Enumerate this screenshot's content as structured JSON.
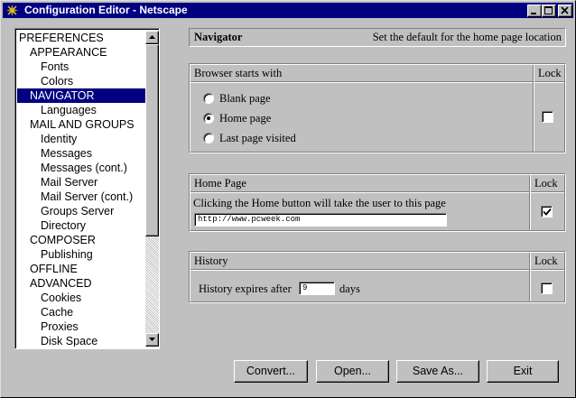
{
  "window": {
    "title": "Configuration Editor - Netscape",
    "titlebar_color": "#000080"
  },
  "tree": {
    "items": [
      {
        "label": "PREFERENCES",
        "level": 0
      },
      {
        "label": "APPEARANCE",
        "level": 1
      },
      {
        "label": "Fonts",
        "level": 2
      },
      {
        "label": "Colors",
        "level": 2
      },
      {
        "label": "NAVIGATOR",
        "level": 1,
        "selected": true
      },
      {
        "label": "Languages",
        "level": 2
      },
      {
        "label": "MAIL AND GROUPS",
        "level": 1
      },
      {
        "label": "Identity",
        "level": 2
      },
      {
        "label": "Messages",
        "level": 2
      },
      {
        "label": "Messages (cont.)",
        "level": 2
      },
      {
        "label": "Mail Server",
        "level": 2
      },
      {
        "label": "Mail Server (cont.)",
        "level": 2
      },
      {
        "label": "Groups Server",
        "level": 2
      },
      {
        "label": "Directory",
        "level": 2
      },
      {
        "label": "COMPOSER",
        "level": 1
      },
      {
        "label": "Publishing",
        "level": 2
      },
      {
        "label": "OFFLINE",
        "level": 1
      },
      {
        "label": "ADVANCED",
        "level": 1
      },
      {
        "label": "Cookies",
        "level": 2
      },
      {
        "label": "Cache",
        "level": 2
      },
      {
        "label": "Proxies",
        "level": 2
      },
      {
        "label": "Disk Space",
        "level": 2
      }
    ],
    "selection_color": "#000080"
  },
  "header": {
    "title": "Navigator",
    "description": "Set the default for the home page location"
  },
  "browser_starts": {
    "heading": "Browser starts with",
    "lock_label": "Lock",
    "options": [
      "Blank page",
      "Home page",
      "Last page visited"
    ],
    "selected_option": "Home page",
    "locked": false
  },
  "home_page": {
    "heading": "Home Page",
    "lock_label": "Lock",
    "description": "Clicking the Home button will take the user to this page",
    "url": "http://www.pcweek.com",
    "locked": true
  },
  "history": {
    "heading": "History",
    "lock_label": "Lock",
    "label_before": "History expires after",
    "days_value": "9",
    "label_after": "days",
    "locked": false
  },
  "buttons": {
    "convert": "Convert...",
    "open": "Open...",
    "save_as": "Save As...",
    "exit": "Exit"
  }
}
